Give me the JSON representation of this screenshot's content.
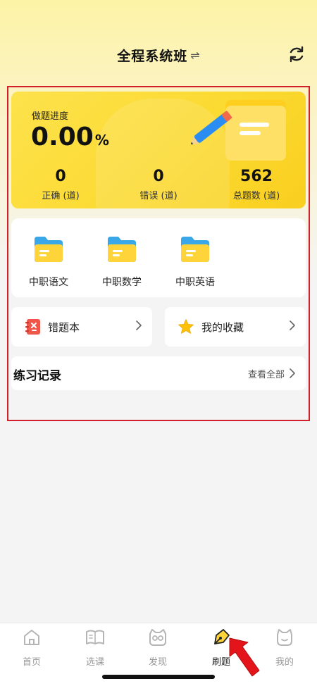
{
  "header": {
    "title": "全程系统班",
    "swap_symbol": "⇌"
  },
  "progress": {
    "label": "做题进度",
    "value": "0.00",
    "unit": "%",
    "stats": [
      {
        "num": "0",
        "label": "正确 (道)"
      },
      {
        "num": "0",
        "label": "错误 (道)"
      },
      {
        "num": "562",
        "label": "总题数 (道)"
      }
    ]
  },
  "subjects": [
    {
      "label": "中职语文"
    },
    {
      "label": "中职数学"
    },
    {
      "label": "中职英语"
    }
  ],
  "quick": {
    "wrong_book": "错题本",
    "favorites": "我的收藏"
  },
  "records": {
    "title": "练习记录",
    "view_all": "查看全部"
  },
  "tabbar": {
    "items": [
      {
        "label": "首页",
        "icon": "home-icon"
      },
      {
        "label": "选课",
        "icon": "book-icon"
      },
      {
        "label": "发现",
        "icon": "cat-face-icon"
      },
      {
        "label": "刷题",
        "icon": "pen-icon",
        "active": true
      },
      {
        "label": "我的",
        "icon": "cat-profile-icon"
      }
    ]
  },
  "colors": {
    "accent_yellow": "#fbd92f",
    "highlight_red": "#d4202a"
  }
}
